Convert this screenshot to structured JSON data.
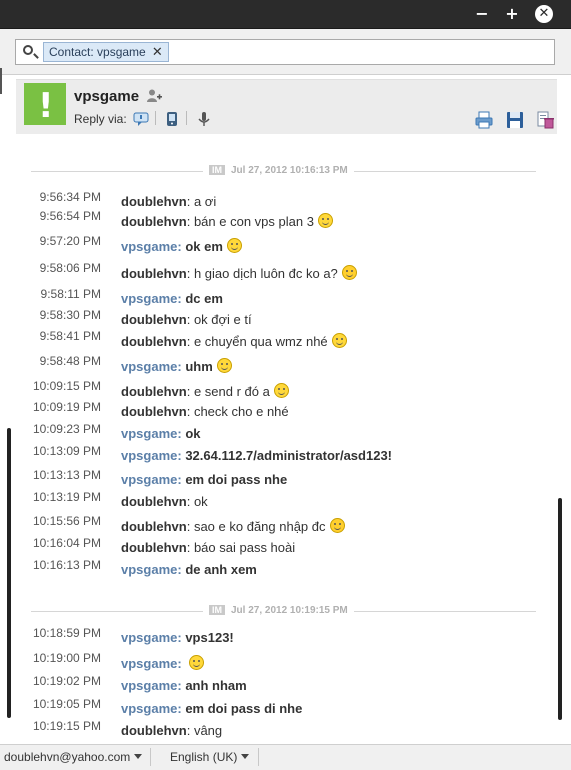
{
  "window": {
    "minimize": "−",
    "maximize": "+",
    "close": "✕"
  },
  "search": {
    "token": "Contact: vpsgame",
    "token_close": "✕"
  },
  "contact": {
    "avatar_glyph": "!",
    "name": "vpsgame",
    "reply_via": "Reply via:"
  },
  "separators": [
    {
      "badge": "IM",
      "label": "Jul 27, 2012 10:16:13 PM"
    },
    {
      "badge": "IM",
      "label": "Jul 27, 2012 10:19:15 PM"
    }
  ],
  "messages": [
    {
      "time": "9:56:34 PM",
      "sender": "doublehvn",
      "text": "a ơi",
      "emoji": false,
      "emoji_type": "",
      "them": false,
      "bold": false
    },
    {
      "time": "9:56:54 PM",
      "sender": "doublehvn",
      "text": "bán e con vps plan 3",
      "emoji": true,
      "emoji_type": "smile",
      "them": false,
      "bold": false
    },
    {
      "time": "9:57:20 PM",
      "sender": "vpsgame",
      "text": "ok em",
      "emoji": true,
      "emoji_type": "smile",
      "them": true,
      "bold": true
    },
    {
      "time": "9:58:06 PM",
      "sender": "doublehvn",
      "text": "h giao dịch luôn đc ko a?",
      "emoji": true,
      "emoji_type": "thinking",
      "them": false,
      "bold": false
    },
    {
      "time": "9:58:11 PM",
      "sender": "vpsgame",
      "text": "dc em",
      "emoji": false,
      "emoji_type": "",
      "them": true,
      "bold": true
    },
    {
      "time": "9:58:30 PM",
      "sender": "doublehvn",
      "text": "ok đợi e tí",
      "emoji": false,
      "emoji_type": "",
      "them": false,
      "bold": false
    },
    {
      "time": "9:58:41 PM",
      "sender": "doublehvn",
      "text": "e chuyển qua wmz nhé",
      "emoji": true,
      "emoji_type": "smile",
      "them": false,
      "bold": false
    },
    {
      "time": "9:58:48 PM",
      "sender": "vpsgame",
      "text": "uhm",
      "emoji": true,
      "emoji_type": "smile",
      "them": true,
      "bold": true
    },
    {
      "time": "10:09:15 PM",
      "sender": "doublehvn",
      "text": "e send r đó a",
      "emoji": true,
      "emoji_type": "smile",
      "them": false,
      "bold": false
    },
    {
      "time": "10:09:19 PM",
      "sender": "doublehvn",
      "text": "check cho e nhé",
      "emoji": false,
      "emoji_type": "",
      "them": false,
      "bold": false
    },
    {
      "time": "10:09:23 PM",
      "sender": "vpsgame",
      "text": "ok",
      "emoji": false,
      "emoji_type": "",
      "them": true,
      "bold": true
    },
    {
      "time": "10:13:09 PM",
      "sender": "vpsgame",
      "text": "32.64.112.7/administrator/asd123!",
      "emoji": false,
      "emoji_type": "",
      "them": true,
      "bold": true
    },
    {
      "time": "10:13:13 PM",
      "sender": "vpsgame",
      "text": "em doi pass nhe",
      "emoji": false,
      "emoji_type": "",
      "them": true,
      "bold": true
    },
    {
      "time": "10:13:19 PM",
      "sender": "doublehvn",
      "text": "ok",
      "emoji": false,
      "emoji_type": "",
      "them": false,
      "bold": false
    },
    {
      "time": "10:15:56 PM",
      "sender": "doublehvn",
      "text": "sao e ko đăng nhập đc",
      "emoji": true,
      "emoji_type": "thinking",
      "them": false,
      "bold": false
    },
    {
      "time": "10:16:04 PM",
      "sender": "doublehvn",
      "text": "báo sai pass hoài",
      "emoji": false,
      "emoji_type": "",
      "them": false,
      "bold": false
    },
    {
      "time": "10:16:13 PM",
      "sender": "vpsgame",
      "text": "de anh xem",
      "emoji": false,
      "emoji_type": "",
      "them": true,
      "bold": true
    },
    {
      "time": "10:18:59 PM",
      "sender": "vpsgame",
      "text": "vps123!",
      "emoji": false,
      "emoji_type": "",
      "them": true,
      "bold": true
    },
    {
      "time": "10:19:00 PM",
      "sender": "vpsgame",
      "text": "",
      "emoji": true,
      "emoji_type": "smile",
      "them": true,
      "bold": true
    },
    {
      "time": "10:19:02 PM",
      "sender": "vpsgame",
      "text": "anh nham",
      "emoji": false,
      "emoji_type": "",
      "them": true,
      "bold": true
    },
    {
      "time": "10:19:05 PM",
      "sender": "vpsgame",
      "text": "em doi pass di nhe",
      "emoji": false,
      "emoji_type": "",
      "them": true,
      "bold": true
    },
    {
      "time": "10:19:15 PM",
      "sender": "doublehvn",
      "text": "vâng",
      "emoji": false,
      "emoji_type": "",
      "them": false,
      "bold": false
    }
  ],
  "footer": {
    "account": "doublehvn@yahoo.com",
    "language": "English (UK)"
  },
  "colors": {
    "titlebar": "#2b2b2b",
    "them_sender": "#5b7fa8",
    "avatar": "#7ac143",
    "token_bg": "#dbe9f7"
  }
}
